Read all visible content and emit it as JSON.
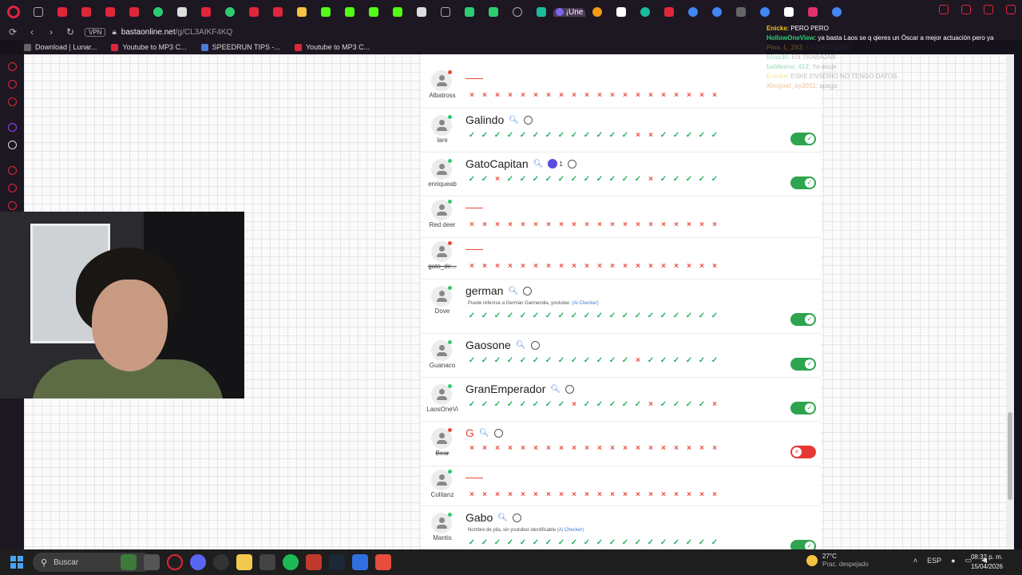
{
  "browser": {
    "url_domain": "bastaonline.net",
    "url_path": "/g/CL3AIKF4KQ",
    "vpn_label": "VPN",
    "active_tab_label": "¡Une",
    "bookmarks": [
      "Download | Lunar...",
      "Youtube to MP3 C...",
      "SPEEDRUN TIPS -...",
      "Youtube to MP3 C..."
    ]
  },
  "chat": [
    {
      "name": "Enicke",
      "text": ": PERO PERO",
      "color": "#f1c40f"
    },
    {
      "name": "HollowOneView",
      "text": ": ya basta Laos se q qieres un Óscar a mejor actuación pero ya",
      "color": "#2ecc71"
    },
    {
      "name": "Pina_L_2X2",
      "text": ": KAJSKDIKDKD",
      "color": "#f39c12"
    },
    {
      "name": "Eliaz30",
      "text": ": EN TRABAJAN",
      "color": "#1abc9c"
    },
    {
      "name": "baldeano_412",
      "text": ": Ya asuje",
      "color": "#27ae60"
    },
    {
      "name": "Enicke",
      "text": ": ESKE ENSERIO NO TENGO DATOS",
      "color": "#f1c40f"
    },
    {
      "name": "Xleojoel_by2011",
      "text": ": apaga",
      "color": "#e67e22"
    }
  ],
  "answers": [
    {
      "word": "",
      "user": "Albatross",
      "online": false,
      "strike": false,
      "note": "",
      "toggle": null,
      "like": "",
      "marks": "xxxxxxxxxxxxxxxxxxxx"
    },
    {
      "word": "Galindo",
      "user": "lare",
      "online": true,
      "strike": false,
      "note": "",
      "toggle": "on",
      "like": "",
      "marks": "vvvvvvvvvvvvvxxvvvvv"
    },
    {
      "word": "GatoCapitan",
      "user": "enriqueab",
      "online": true,
      "strike": false,
      "note": "",
      "toggle": "on",
      "like": "1",
      "marks": "vvxvvvvvvvvvvvxvvvvv"
    },
    {
      "word": "",
      "user": "Red deer",
      "online": true,
      "strike": false,
      "note": "",
      "toggle": null,
      "like": "",
      "marks": "xxxxxxxxxxxxxxxxxxxx"
    },
    {
      "word": "",
      "user": "gato_de...",
      "online": false,
      "strike": true,
      "note": "",
      "toggle": null,
      "like": "",
      "marks": "xxxxxxxxxxxxxxxxxxxx"
    },
    {
      "word": "german",
      "user": "Dove",
      "online": true,
      "strike": false,
      "note": "Puede referirse a Germán Garmendia, youtuber.",
      "toggle": "on",
      "like": "",
      "marks": "vvvvvvvvvvvvvvvvvvvv"
    },
    {
      "word": "Gaosone",
      "user": "Guanaco",
      "online": true,
      "strike": false,
      "note": "",
      "toggle": "on",
      "like": "",
      "marks": "vvvvvvvvvvvvvxvvvvvv"
    },
    {
      "word": "GranEmperador",
      "user": "LaosOneVi",
      "online": true,
      "strike": false,
      "note": "",
      "toggle": "on",
      "like": "",
      "marks": "vvvvvvvvxvvvvvxvvvvx"
    },
    {
      "word": "G",
      "user": "Bear",
      "online": false,
      "strike": true,
      "note": "",
      "toggle": "off",
      "like": "",
      "marks": "xxxxxxxxxxxxxxxxxxxx"
    },
    {
      "word": "",
      "user": "Colitanz",
      "online": true,
      "strike": false,
      "note": "",
      "toggle": null,
      "like": "",
      "marks": "xxxxxxxxxxxxxxxxxxxx"
    },
    {
      "word": "Gabo",
      "user": "Mantis",
      "online": true,
      "strike": false,
      "note": "Nombre de pila, sin youtuber identificable",
      "toggle": "on",
      "like": "",
      "marks": "vvvvvvvvvvvvvvvvvvvv"
    }
  ],
  "ai_checker_label": "(Ai Checker)",
  "taskbar": {
    "search_placeholder": "Buscar",
    "weather_temp": "27°C",
    "weather_desc": "Prac. despejado",
    "lang": "ESP",
    "time": "08:32 p. m.",
    "date": "15/04/2026"
  },
  "colors": {
    "accent": "#e0263a",
    "ok": "#27ae60",
    "error": "#e74c3c",
    "toggle_on": "#2ea44f"
  }
}
